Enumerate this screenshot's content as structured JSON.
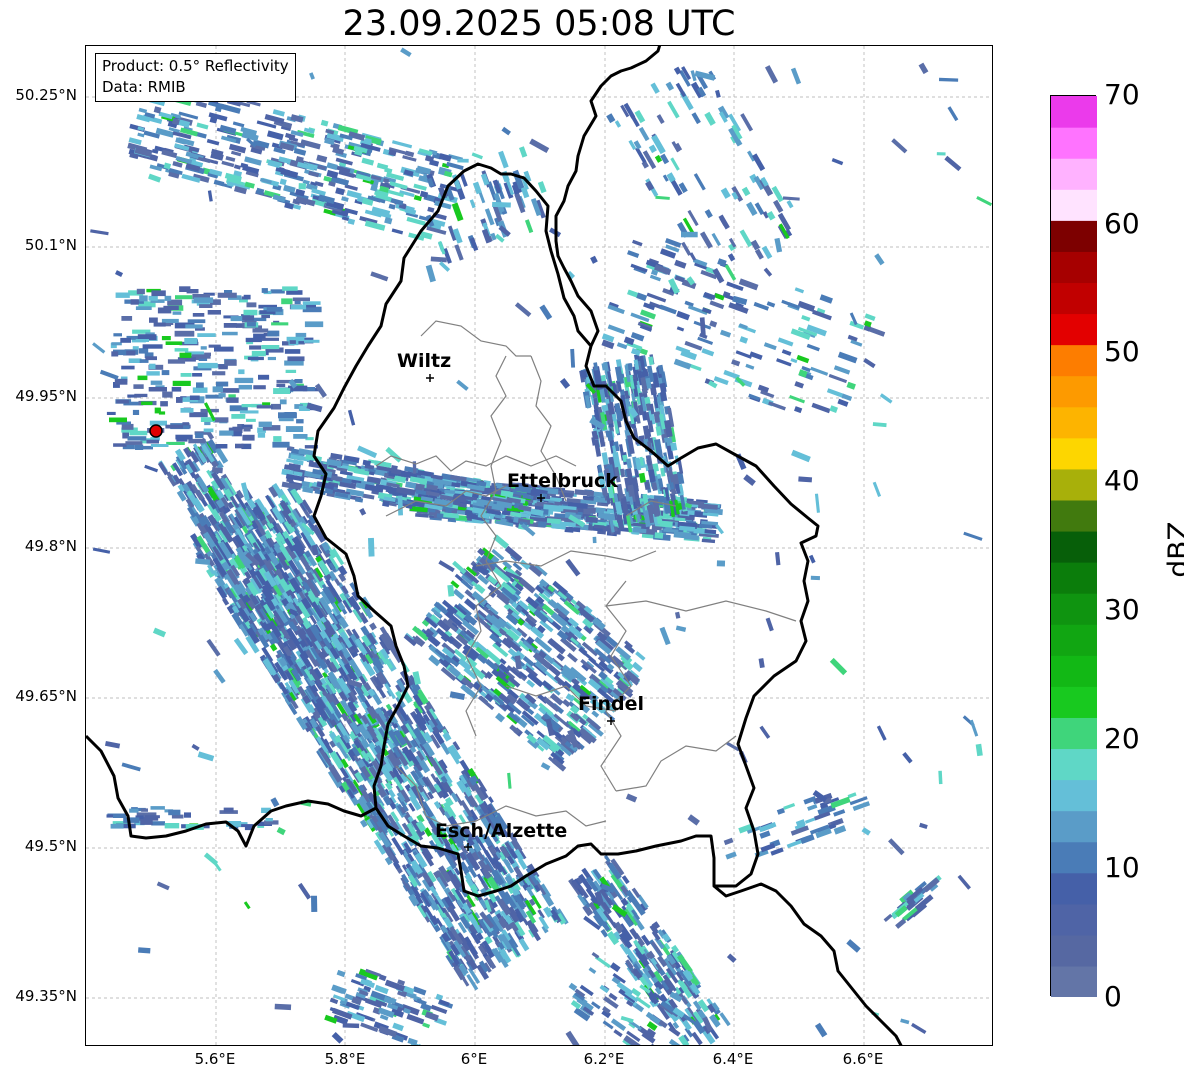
{
  "title": "23.09.2025 05:08 UTC",
  "info": {
    "product": "Product: 0.5° Reflectivity",
    "data": "Data: RMIB"
  },
  "axes": {
    "x_ticks": [
      "5.6°E",
      "5.8°E",
      "6°E",
      "6.2°E",
      "6.4°E",
      "6.6°E"
    ],
    "y_ticks": [
      "50.25°N",
      "50.1°N",
      "49.95°N",
      "49.8°N",
      "49.65°N",
      "49.5°N",
      "49.35°N"
    ]
  },
  "colorbar": {
    "label": "dBZ",
    "ticks": [
      "0",
      "10",
      "20",
      "30",
      "40",
      "50",
      "60",
      "70"
    ],
    "colors": [
      "#6375a7",
      "#5668a2",
      "#4f64a6",
      "#4560a8",
      "#4a7cb7",
      "#5a9cc8",
      "#64bfd8",
      "#5fd7c6",
      "#3fd57b",
      "#18c91f",
      "#12b815",
      "#11a612",
      "#0f9410",
      "#0b7d0b",
      "#075f09",
      "#417a0e",
      "#a8b00a",
      "#fdd600",
      "#fdb400",
      "#fd9a00",
      "#fd7d00",
      "#e30000",
      "#c10000",
      "#a60000",
      "#7d0000",
      "#ffe3ff",
      "#ffb2ff",
      "#ff73ff",
      "#eb3aeb"
    ]
  },
  "cities": [
    {
      "name": "Wiltz"
    },
    {
      "name": "Ettelbruck"
    },
    {
      "name": "Findel"
    },
    {
      "name": "Esch/Alzette"
    }
  ],
  "radar_site_color": "#e00000"
}
